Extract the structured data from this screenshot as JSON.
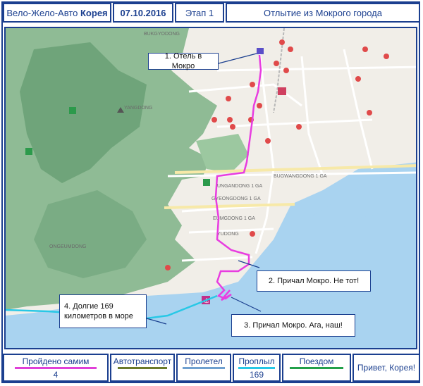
{
  "header": {
    "project": "Вело-Жело-Авто",
    "country": "Корея",
    "date": "07.10.2016",
    "stage": "Этап 1",
    "title": "Отлытие из Мокрого города"
  },
  "map": {
    "district_labels": [
      "YANGDONG",
      "BUKGYODONG",
      "UNGANDONG 1 GA",
      "GYEONGDONG 1 GA",
      "EUMGDONG 1 GA",
      "YUDONG",
      "ONGEUMDONG",
      "BUGWANGDONG 1 GA"
    ],
    "callouts": {
      "hotel": "1. Отель в Мокро",
      "pier_wrong": "2. Причал Мокро. Не тот!",
      "pier_right": "3. Причал Мокро. Ага, наш!",
      "sea": "4. Долгие 169 километров в море"
    },
    "colors": {
      "route_bike": "#e83de0",
      "route_sea": "#28c8e6",
      "water": "#a9d3f0",
      "hills": "#7fb08a",
      "frame": "#1b3f8f"
    }
  },
  "footer": {
    "items": [
      {
        "label": "Пройдено самим",
        "value": "4",
        "color": "#e040d8"
      },
      {
        "label": "Автотранспорт",
        "value": "",
        "color": "#6b7a2a"
      },
      {
        "label": "Пролетел",
        "value": "",
        "color": "#6fa0d0"
      },
      {
        "label": "Проплыл",
        "value": "169",
        "color": "#28c8e6"
      },
      {
        "label": "Поездом",
        "value": "",
        "color": "#22a04a"
      }
    ],
    "greeting": "Привет, Корея!"
  }
}
